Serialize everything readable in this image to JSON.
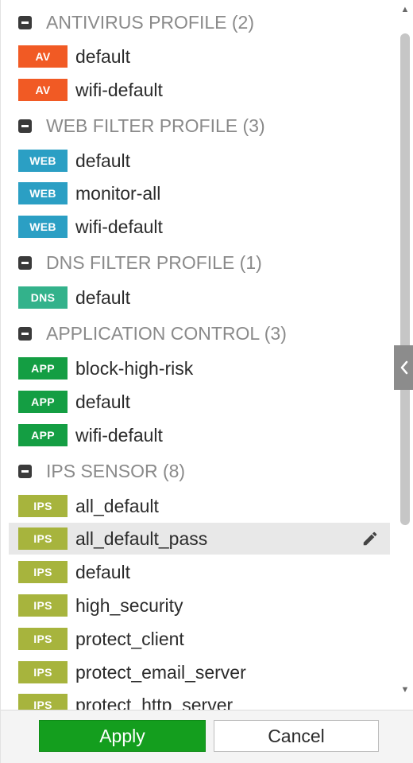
{
  "colors": {
    "av": "#f15a24",
    "web": "#2b9fc4",
    "dns": "#33b28b",
    "app": "#149e43",
    "ips": "#a7b43d",
    "apply": "#149e1e"
  },
  "groups": [
    {
      "title": "ANTIVIRUS PROFILE (2)",
      "badge": "AV",
      "items": [
        "default",
        "wifi-default"
      ]
    },
    {
      "title": "WEB FILTER PROFILE (3)",
      "badge": "WEB",
      "items": [
        "default",
        "monitor-all",
        "wifi-default"
      ]
    },
    {
      "title": "DNS FILTER PROFILE (1)",
      "badge": "DNS",
      "items": [
        "default"
      ]
    },
    {
      "title": "APPLICATION CONTROL (3)",
      "badge": "APP",
      "items": [
        "block-high-risk",
        "default",
        "wifi-default"
      ]
    },
    {
      "title": "IPS SENSOR (8)",
      "badge": "IPS",
      "items": [
        "all_default",
        "all_default_pass",
        "default",
        "high_security",
        "protect_client",
        "protect_email_server",
        "protect_http_server"
      ]
    }
  ],
  "selected_item": "all_default_pass",
  "footer": {
    "apply_label": "Apply",
    "cancel_label": "Cancel"
  },
  "icons": {
    "group_toggle": "collapse-minus-icon",
    "edit": "pencil-icon",
    "side_toggle": "chevron-left-icon",
    "scroll_up": "scroll-up-arrow-icon",
    "scroll_down": "scroll-down-arrow-icon"
  }
}
